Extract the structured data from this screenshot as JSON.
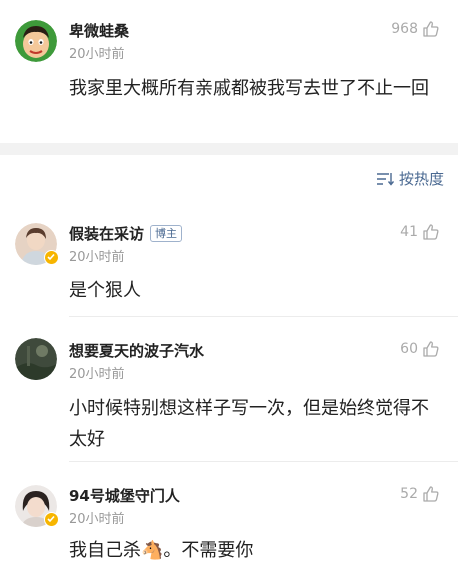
{
  "top_comment": {
    "username": "卑微蛙桑",
    "time": "20小时前",
    "likes": "968",
    "text": "我家里大概所有亲戚都被我写去世了不止一回",
    "avatar_icon": "cartoon-face-avatar"
  },
  "sort": {
    "label": "按热度",
    "icon": "sort-lines-icon"
  },
  "replies": [
    {
      "username": "假装在采访",
      "tag": "博主",
      "time": "20小时前",
      "likes": "41",
      "text": "是个狠人",
      "verified": true
    },
    {
      "username": "想要夏天的波子汽水",
      "time": "20小时前",
      "likes": "60",
      "text": "小时候特别想这样子写一次，但是始终觉得不太好",
      "verified": false
    },
    {
      "username": "94号城堡守门人",
      "time": "20小时前",
      "likes": "52",
      "text": "我自己杀🐴。不需要你",
      "verified": true
    }
  ],
  "colors": {
    "link_blue": "#4b6a92",
    "verified_gold": "#f7b500",
    "separator": "#f2f2f2"
  }
}
